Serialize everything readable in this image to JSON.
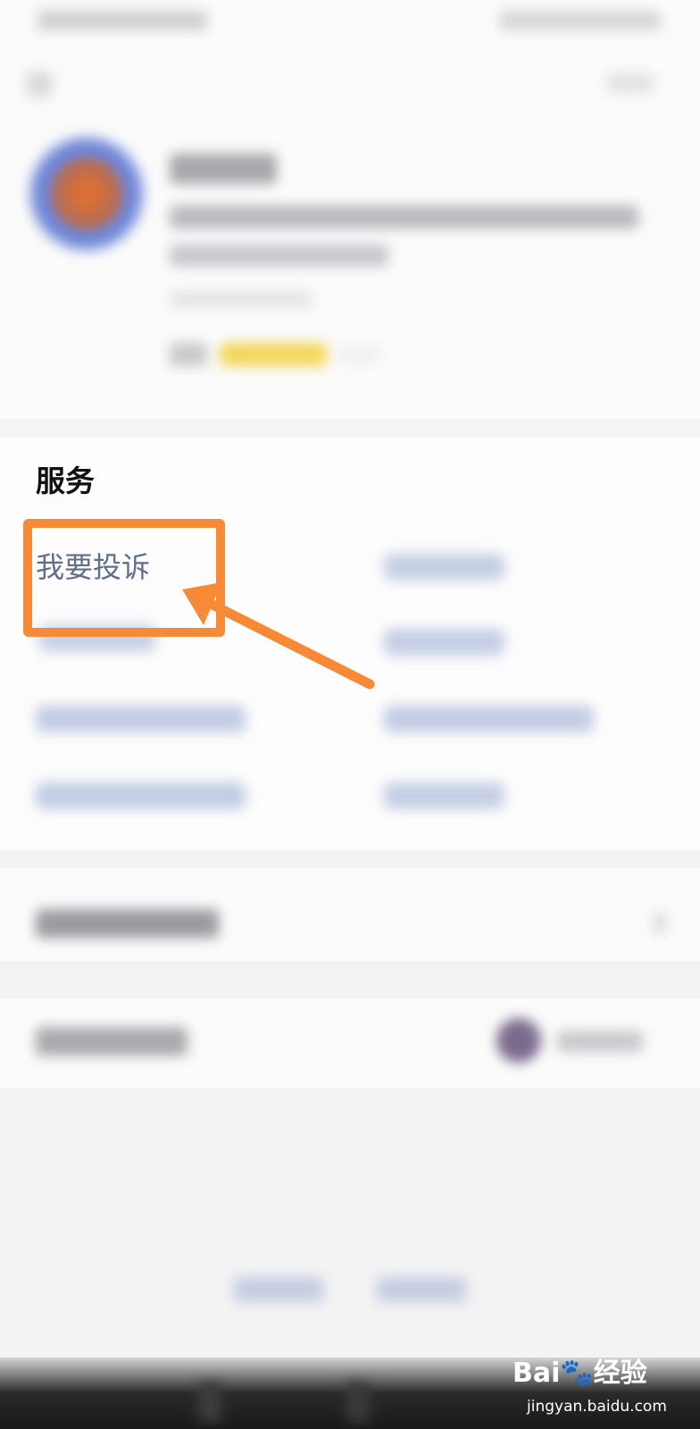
{
  "services": {
    "title": "服务",
    "complaint_label": "我要投诉"
  },
  "annotation": {
    "color": "#f68a36"
  },
  "watermark": {
    "logo": "Bai🐾经验",
    "url": "jingyan.baidu.com"
  }
}
